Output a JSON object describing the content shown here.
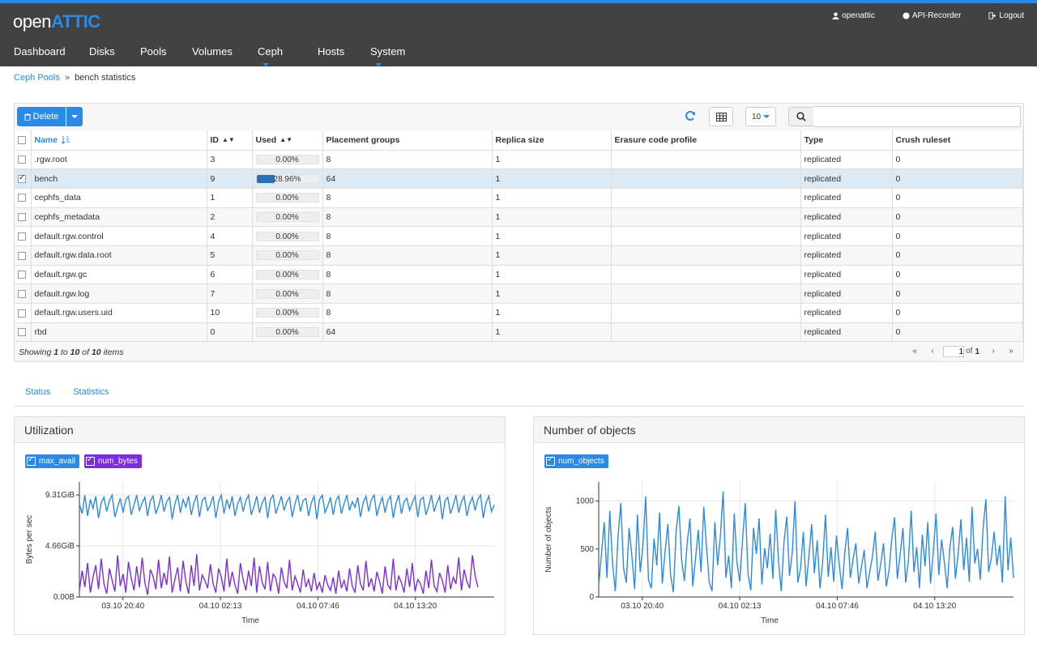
{
  "app": {
    "logo_open": "open",
    "logo_attic": "ATTIC",
    "user": "openattic",
    "api_recorder": "API-Recorder",
    "logout": "Logout"
  },
  "nav": [
    {
      "label": "Dashboard",
      "dropdown": false
    },
    {
      "label": "Disks",
      "dropdown": false
    },
    {
      "label": "Pools",
      "dropdown": false
    },
    {
      "label": "Volumes",
      "dropdown": false
    },
    {
      "label": "Ceph",
      "dropdown": true
    },
    {
      "label": "Hosts",
      "dropdown": false
    },
    {
      "label": "System",
      "dropdown": true
    }
  ],
  "breadcrumb": {
    "parent": "Ceph Pools",
    "separator": "»",
    "current": "bench statistics"
  },
  "toolbar": {
    "delete_label": "Delete",
    "page_size": "10",
    "search_placeholder": ""
  },
  "table": {
    "headers": [
      "Name",
      "ID",
      "Used",
      "Placement groups",
      "Replica size",
      "Erasure code profile",
      "Type",
      "Crush ruleset"
    ],
    "rows": [
      {
        "name": ".rgw.root",
        "id": "3",
        "used": 0.0,
        "used_label": "0.00%",
        "pg": "8",
        "replica": "1",
        "ecp": "",
        "type": "replicated",
        "crush": "0",
        "selected": false
      },
      {
        "name": "bench",
        "id": "9",
        "used": 28.96,
        "used_label": "28.96%",
        "pg": "64",
        "replica": "1",
        "ecp": "",
        "type": "replicated",
        "crush": "0",
        "selected": true
      },
      {
        "name": "cephfs_data",
        "id": "1",
        "used": 0.0,
        "used_label": "0.00%",
        "pg": "8",
        "replica": "1",
        "ecp": "",
        "type": "replicated",
        "crush": "0",
        "selected": false
      },
      {
        "name": "cephfs_metadata",
        "id": "2",
        "used": 0.0,
        "used_label": "0.00%",
        "pg": "8",
        "replica": "1",
        "ecp": "",
        "type": "replicated",
        "crush": "0",
        "selected": false
      },
      {
        "name": "default.rgw.control",
        "id": "4",
        "used": 0.0,
        "used_label": "0.00%",
        "pg": "8",
        "replica": "1",
        "ecp": "",
        "type": "replicated",
        "crush": "0",
        "selected": false
      },
      {
        "name": "default.rgw.data.root",
        "id": "5",
        "used": 0.0,
        "used_label": "0.00%",
        "pg": "8",
        "replica": "1",
        "ecp": "",
        "type": "replicated",
        "crush": "0",
        "selected": false
      },
      {
        "name": "default.rgw.gc",
        "id": "6",
        "used": 0.0,
        "used_label": "0.00%",
        "pg": "8",
        "replica": "1",
        "ecp": "",
        "type": "replicated",
        "crush": "0",
        "selected": false
      },
      {
        "name": "default.rgw.log",
        "id": "7",
        "used": 0.0,
        "used_label": "0.00%",
        "pg": "8",
        "replica": "1",
        "ecp": "",
        "type": "replicated",
        "crush": "0",
        "selected": false
      },
      {
        "name": "default.rgw.users.uid",
        "id": "10",
        "used": 0.0,
        "used_label": "0.00%",
        "pg": "8",
        "replica": "1",
        "ecp": "",
        "type": "replicated",
        "crush": "0",
        "selected": false
      },
      {
        "name": "rbd",
        "id": "0",
        "used": 0.0,
        "used_label": "0.00%",
        "pg": "64",
        "replica": "1",
        "ecp": "",
        "type": "replicated",
        "crush": "0",
        "selected": false
      }
    ]
  },
  "footer": {
    "showing": "Showing",
    "from": "1",
    "to_word": "to",
    "to": "10",
    "of_word": "of",
    "total": "10",
    "items_word": "items",
    "page": "1",
    "of_pages": "of",
    "pages": "1"
  },
  "tabs": [
    "Status",
    "Statistics"
  ],
  "utilization": {
    "title": "Utilization",
    "legend": [
      {
        "label": "max_avail",
        "color": "#2a8ae6"
      },
      {
        "label": "num_bytes",
        "color": "#7a2ee0"
      }
    ]
  },
  "objects": {
    "title": "Number of objects",
    "legend": [
      {
        "label": "num_objects",
        "color": "#2a8ae6"
      }
    ]
  },
  "chart_data": [
    {
      "type": "line",
      "title": "Utilization",
      "xlabel": "Time",
      "ylabel": "Bytes per sec",
      "x_ticks": [
        "03.10 20:40",
        "04.10 02:13",
        "04.10 07:46",
        "04.10 13:20"
      ],
      "y_ticks": [
        "0.00B",
        "4.66GiB",
        "9.31GiB"
      ],
      "ylim": [
        0,
        10.5
      ],
      "grid": true,
      "series": [
        {
          "name": "max_avail",
          "color": "#2a8ae6",
          "values": [
            8.5,
            7.6,
            9.3,
            7.4,
            8.9,
            8.1,
            9.2,
            7.2,
            8.6,
            9.1,
            7.8,
            8.8,
            9.3,
            7.3,
            8.2,
            9.0,
            7.7,
            8.9,
            9.2,
            7.5,
            8.4,
            9.3,
            7.9,
            8.6,
            9.1,
            7.4,
            8.8,
            9.2,
            7.6,
            8.3,
            9.3,
            7.8,
            8.7,
            9.1,
            7.1,
            8.5,
            9.3,
            7.7,
            8.9,
            8.2,
            9.2,
            7.5,
            8.6,
            9.3,
            7.3,
            8.8,
            9.1,
            7.9,
            8.4,
            9.2,
            7.2,
            8.7,
            9.3,
            7.6,
            8.9,
            8.1,
            9.2,
            7.4,
            8.5,
            9.1,
            7.8,
            8.8,
            9.3,
            7.5,
            8.3,
            9.2,
            7.7,
            8.6,
            9.1,
            7.2,
            8.9,
            9.3,
            7.6,
            8.4,
            9.2,
            7.9,
            8.7,
            9.1,
            7.3,
            8.5,
            9.3,
            7.8,
            8.8,
            9.0,
            7.4,
            8.6,
            9.2,
            7.1,
            8.9,
            9.3,
            7.7,
            8.3,
            9.1,
            7.5,
            8.8,
            9.2,
            7.6,
            8.5,
            9.3,
            7.9,
            8.7,
            8.2,
            9.1,
            7.3,
            8.6,
            9.2,
            7.8,
            8.9,
            9.3,
            7.4,
            8.4,
            9.1,
            7.7,
            8.8,
            9.2,
            7.2,
            8.5,
            9.3,
            7.6,
            8.7,
            9.0,
            7.9,
            8.6,
            9.2,
            7.3,
            8.9,
            9.1,
            7.5,
            8.3,
            9.3,
            7.8,
            8.6,
            9.2,
            7.1,
            8.8,
            9.1,
            7.6,
            8.4,
            9.3,
            7.7,
            8.7,
            9.2,
            7.4,
            8.5,
            9.1,
            7.9,
            8.9,
            9.3,
            7.2,
            8.6,
            9.2,
            7.8,
            8.4
          ]
        },
        {
          "name": "num_bytes",
          "color": "#7a2ee0",
          "values": [
            0.6,
            2.4,
            0.9,
            3.1,
            0.4,
            1.8,
            2.9,
            0.7,
            3.5,
            1.2,
            0.3,
            2.6,
            1.5,
            0.5,
            3.8,
            1.0,
            2.1,
            0.4,
            3.2,
            1.7,
            0.6,
            2.8,
            0.9,
            3.6,
            1.3,
            0.2,
            2.5,
            1.9,
            0.7,
            3.4,
            0.8,
            2.2,
            1.1,
            3.7,
            0.4,
            1.6,
            2.7,
            0.5,
            3.3,
            1.4,
            0.3,
            2.9,
            1.0,
            3.9,
            0.6,
            2.0,
            1.5,
            0.8,
            3.0,
            1.2,
            0.4,
            2.6,
            1.8,
            0.5,
            3.5,
            0.9,
            2.3,
            1.1,
            0.3,
            3.1,
            1.6,
            0.6,
            2.4,
            1.0,
            3.6,
            0.4,
            2.8,
            1.3,
            0.7,
            3.2,
            0.5,
            2.1,
            1.7,
            0.3,
            2.7,
            1.4,
            0.8,
            3.4,
            0.6,
            1.9,
            1.2,
            0.4,
            2.5,
            0.9,
            1.6,
            0.5,
            2.2,
            0.7,
            1.3,
            0.4,
            2.0,
            1.1,
            0.6,
            1.8,
            0.3,
            2.4,
            0.8,
            1.5,
            0.5,
            2.6,
            1.0,
            0.4,
            2.9,
            1.2,
            0.6,
            3.3,
            0.9,
            1.7,
            0.5,
            2.3,
            1.4,
            0.3,
            2.8,
            1.1,
            0.7,
            3.5,
            0.6,
            1.9,
            1.3,
            0.4,
            2.6,
            0.9,
            3.1,
            0.5,
            1.6,
            1.2,
            0.3,
            2.4,
            0.8,
            3.4,
            1.0,
            0.5,
            2.2,
            1.5,
            0.4,
            2.9,
            0.7,
            1.8,
            1.2,
            3.6,
            0.6,
            2.5,
            1.4,
            0.8,
            3.8,
            2.0,
            0.9
          ]
        }
      ]
    },
    {
      "type": "line",
      "title": "Number of objects",
      "xlabel": "Time",
      "ylabel": "Number of objects",
      "x_ticks": [
        "03.10 20:40",
        "04.10 02:13",
        "04.10 07:46",
        "04.10 13:20"
      ],
      "y_ticks": [
        "0",
        "500",
        "1000"
      ],
      "ylim": [
        0,
        1200
      ],
      "grid": true,
      "series": [
        {
          "name": "num_objects",
          "color": "#2a8ae6",
          "values": [
            120,
            450,
            780,
            200,
            900,
            350,
            60,
            640,
            980,
            300,
            150,
            720,
            420,
            80,
            860,
            260,
            540,
            1050,
            180,
            90,
            610,
            330,
            880,
            140,
            470,
            760,
            230,
            50,
            690,
            950,
            380,
            170,
            560,
            820,
            110,
            400,
            700,
            260,
            940,
            520,
            150,
            60,
            780,
            330,
            640,
            1100,
            200,
            430,
            90,
            870,
            360,
            160,
            590,
            980,
            240,
            70,
            720,
            450,
            820,
            130,
            510,
            300,
            660,
            190,
            910,
            380,
            60,
            570,
            840,
            220,
            460,
            1000,
            150,
            300,
            680,
            110,
            420,
            760,
            250,
            590,
            90,
            370,
            860,
            210,
            520,
            160,
            640,
            330,
            80,
            470,
            720,
            200,
            390,
            560,
            140,
            310,
            490,
            90,
            260,
            420,
            680,
            170,
            350,
            560,
            110,
            280,
            610,
            830,
            190,
            440,
            720,
            150,
            380,
            900,
            260,
            520,
            90,
            650,
            320,
            780,
            140,
            470,
            870,
            230,
            600,
            360,
            90,
            520,
            730,
            190,
            450,
            810,
            280,
            620,
            160,
            940,
            350,
            500,
            180,
            720,
            1020,
            260,
            410,
            680,
            330,
            540,
            150,
            1050,
            280,
            620,
            200
          ]
        }
      ]
    }
  ]
}
